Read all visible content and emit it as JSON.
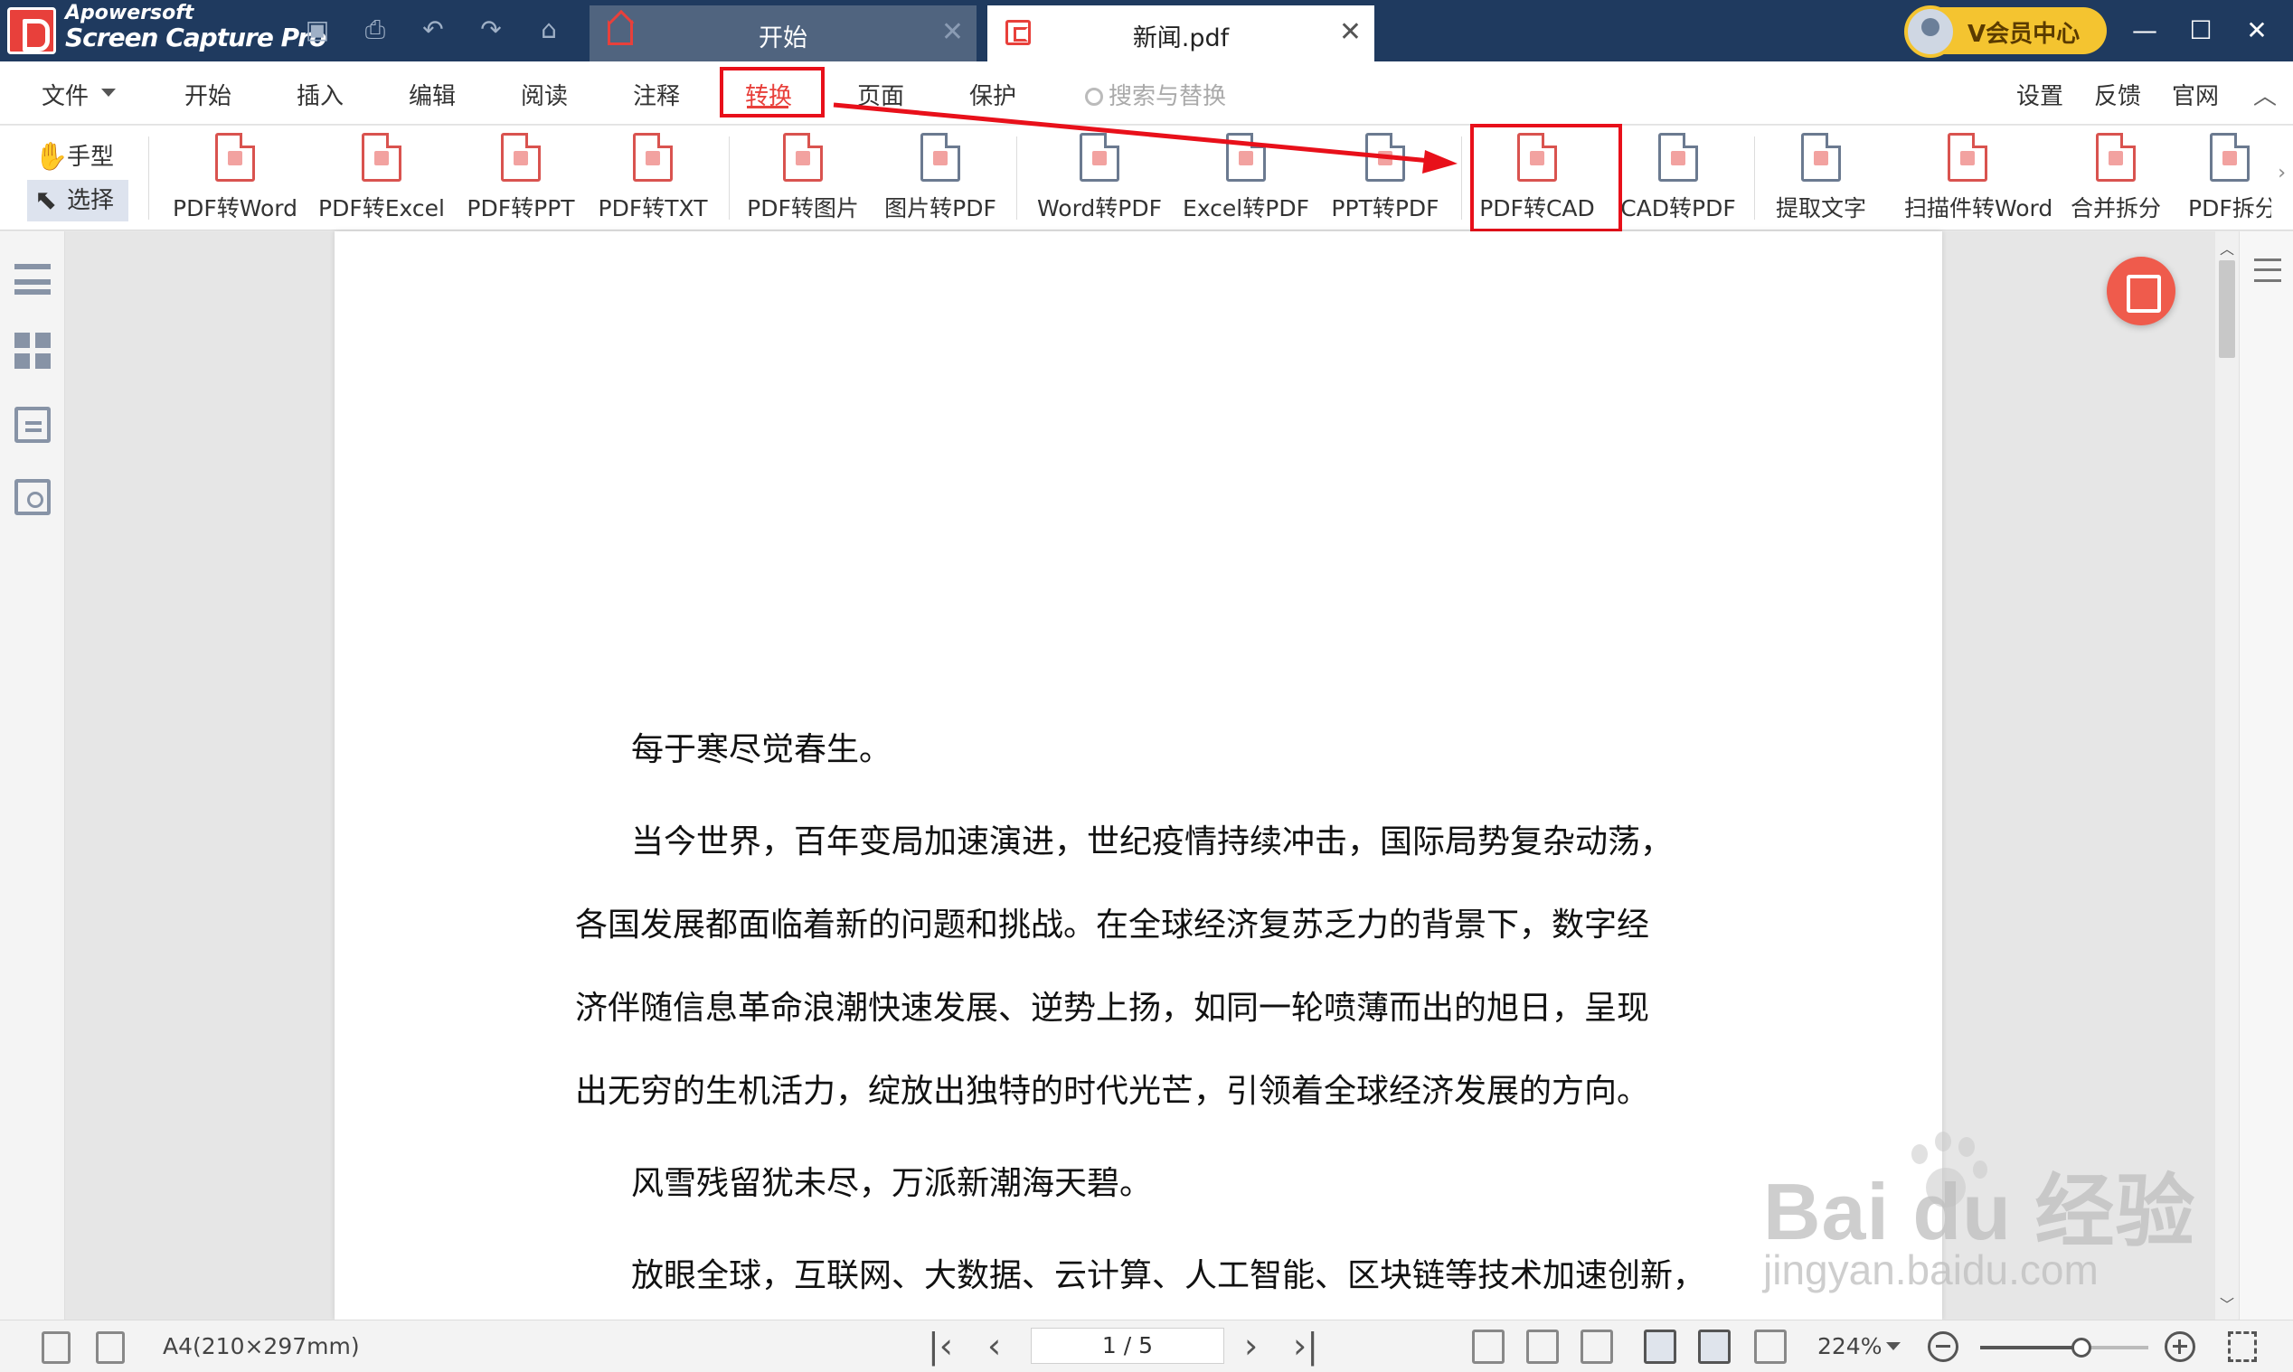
{
  "titlebar": {
    "watermark_line1": "Apowersoft",
    "watermark_line2": "Screen Capture Pro",
    "tabs": [
      {
        "label": "开始",
        "close": "✕"
      },
      {
        "label": "新闻.pdf",
        "close": "✕"
      }
    ],
    "member_label": "V会员中心",
    "window_buttons": {
      "minimize": "—",
      "maximize": "☐",
      "close": "✕"
    },
    "quick_icons": [
      "save-icon",
      "print-icon",
      "undo-icon",
      "redo-icon",
      "home-icon"
    ]
  },
  "menubar": {
    "file": "文件",
    "items": [
      "开始",
      "插入",
      "编辑",
      "阅读",
      "注释",
      "转换",
      "页面",
      "保护"
    ],
    "active": "转换",
    "search_placeholder": "搜索与替换",
    "right_items": [
      "设置",
      "反馈",
      "官网"
    ],
    "collapse": "︿"
  },
  "ribbon": {
    "hand_tool": "手型",
    "select_tool": "选择",
    "tools": [
      {
        "label": "PDF转Word",
        "icon": "pdf-to-word-icon"
      },
      {
        "label": "PDF转Excel",
        "icon": "pdf-to-excel-icon"
      },
      {
        "label": "PDF转PPT",
        "icon": "pdf-to-ppt-icon"
      },
      {
        "label": "PDF转TXT",
        "icon": "pdf-to-txt-icon"
      },
      {
        "label": "PDF转图片",
        "icon": "pdf-to-image-icon"
      },
      {
        "label": "图片转PDF",
        "icon": "image-to-pdf-icon"
      },
      {
        "label": "Word转PDF",
        "icon": "word-to-pdf-icon"
      },
      {
        "label": "Excel转PDF",
        "icon": "excel-to-pdf-icon"
      },
      {
        "label": "PPT转PDF",
        "icon": "ppt-to-pdf-icon"
      },
      {
        "label": "PDF转CAD",
        "icon": "pdf-to-cad-icon"
      },
      {
        "label": "CAD转PDF",
        "icon": "cad-to-pdf-icon"
      },
      {
        "label": "提取文字",
        "icon": "extract-text-icon"
      },
      {
        "label": "扫描件转Word",
        "icon": "scan-to-word-icon"
      },
      {
        "label": "合并拆分",
        "icon": "merge-split-icon"
      },
      {
        "label": "PDF拆分",
        "icon": "pdf-split-icon"
      }
    ],
    "more": "›",
    "highlighted_tool": "PDF转CAD",
    "highlight_color": "#e8101a"
  },
  "document": {
    "paragraphs": [
      "每于寒尽觉春生。",
      "当今世界，百年变局加速演进，世纪疫情持续冲击，国际局势复杂动荡，",
      "各国发展都面临着新的问题和挑战。在全球经济复苏乏力的背景下，数字经",
      "济伴随信息革命浪潮快速发展、逆势上扬，如同一轮喷薄而出的旭日，呈现",
      "出无穷的生机活力，绽放出独特的时代光芒，引领着全球经济发展的方向。",
      "风雪残留犹未尽，万派新潮海天碧。",
      "放眼全球，互联网、大数据、云计算、人工智能、区块链等技术加速创新，"
    ]
  },
  "watermark": {
    "logo": "Bai du 经验",
    "url": "jingyan.baidu.com"
  },
  "statusbar": {
    "page_size": "A4(210×297mm)",
    "page_indicator": "1 / 5",
    "zoom": "224%",
    "zoom_slider_fraction": 0.6,
    "nav": {
      "first": "|‹",
      "prev": "‹",
      "next": "›",
      "last": "›|"
    }
  },
  "colors": {
    "titlebar_bg": "#1f3a5f",
    "accent_red": "#e8403b",
    "member_gold": "#f4c430"
  }
}
